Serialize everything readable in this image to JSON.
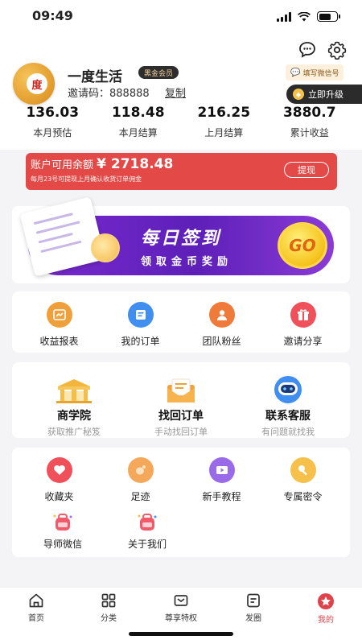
{
  "status_bar": {
    "time": "09:49"
  },
  "header": {
    "wechat_tag": "填写微信号",
    "upgrade_label": "立即升级",
    "username": "一度生活",
    "member_badge": "黑金会员",
    "invite_code": "邀请码：888888",
    "copy_label": "复制",
    "stats": [
      {
        "value": "136.03",
        "label": "本月预估"
      },
      {
        "value": "118.48",
        "label": "本月结算"
      },
      {
        "value": "216.25",
        "label": "上月结算"
      },
      {
        "value": "3880.7",
        "label": "累计收益"
      }
    ]
  },
  "balance": {
    "label": "账户可用余额",
    "amount": "¥ 2718.48",
    "note": "每月23号可提现上月确认收货订单佣金",
    "withdraw_label": "提现"
  },
  "sign_banner": {
    "title": "每日签到",
    "subtitle": "领取金币奖励",
    "go_label": "GO"
  },
  "quick_menu": [
    {
      "label": "收益报表",
      "color": "#f0a03a"
    },
    {
      "label": "我的订单",
      "color": "#3f8ef0"
    },
    {
      "label": "团队粉丝",
      "color": "#f07a3a"
    },
    {
      "label": "邀请分享",
      "color": "#f0505a"
    }
  ],
  "service_menu": [
    {
      "title": "商学院",
      "subtitle": "获取推广秘笈"
    },
    {
      "title": "找回订单",
      "subtitle": "手动找回订单"
    },
    {
      "title": "联系客服",
      "subtitle": "有问题就找我"
    }
  ],
  "more_menu": [
    {
      "label": "收藏夹",
      "color": "#f0505a"
    },
    {
      "label": "足迹",
      "color": "#f6a85a"
    },
    {
      "label": "新手教程",
      "color": "#9a6be8"
    },
    {
      "label": "专属密令",
      "color": "#f6c04a"
    },
    {
      "label": "导师微信",
      "color": "#f05a6a"
    },
    {
      "label": "关于我们",
      "color": "#f05a6a"
    }
  ],
  "tabbar": [
    {
      "label": "首页"
    },
    {
      "label": "分类"
    },
    {
      "label": "尊享特权"
    },
    {
      "label": "发圈"
    },
    {
      "label": "我的"
    }
  ],
  "accent_color": "#e0424a"
}
